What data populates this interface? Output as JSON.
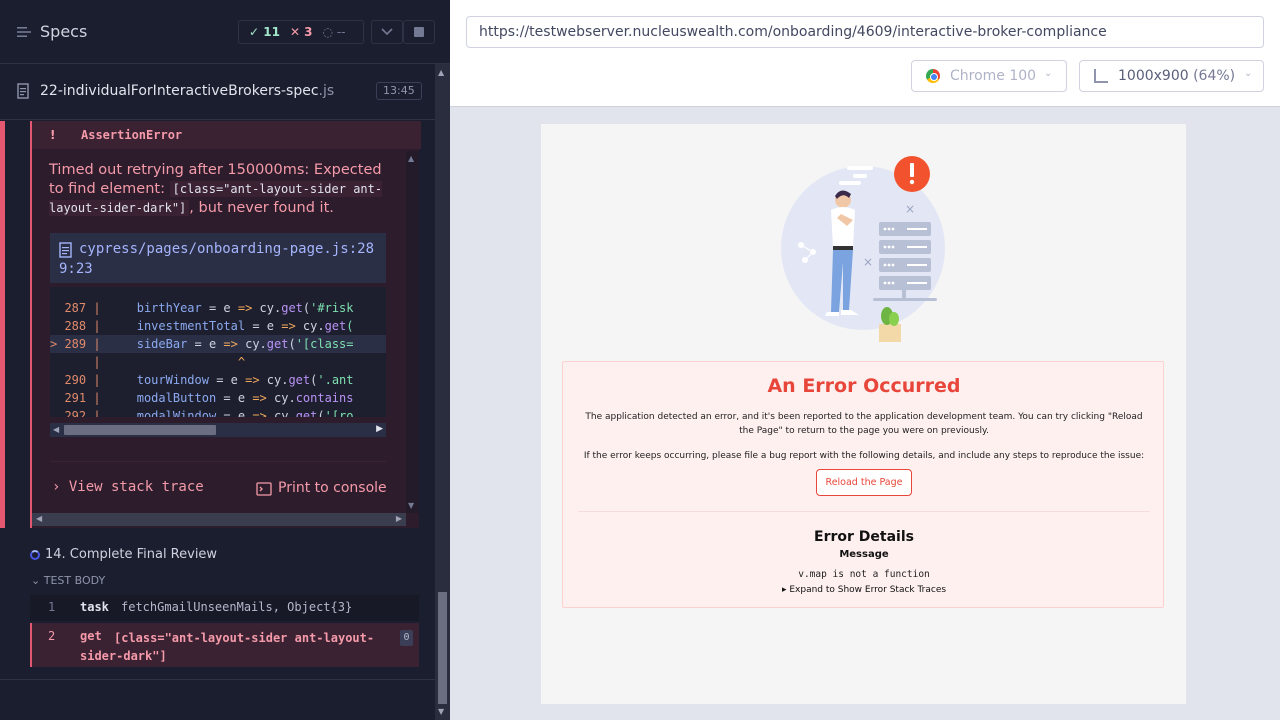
{
  "reporter": {
    "title": "Specs",
    "stats": {
      "passed": "11",
      "failed": "3",
      "pending": "--"
    },
    "file": {
      "name": "22-individualForInteractiveBrokers-spec",
      "ext": ".js",
      "duration": "13:45"
    }
  },
  "error": {
    "bang": "!",
    "name": "AssertionError",
    "message_pre": "Timed out retrying after 150000ms: Expected to find element: ",
    "selector": "[class=\"ant-layout-sider ant-layout-sider-dark\"]",
    "message_post": ", but never found it.",
    "code_frame_file": "cypress/pages/onboarding-page.js:289:23",
    "code_lines": [
      {
        "num": "287",
        "prop": "birthYear",
        "arg": "'#risk"
      },
      {
        "num": "288",
        "prop": "investmentTotal",
        "arg": "("
      },
      {
        "num": "289",
        "prop": "sideBar",
        "arg": "'[class="
      },
      {
        "num": "290",
        "prop": "tourWindow",
        "arg": "'.ant"
      },
      {
        "num": "291",
        "prop": "modalButton",
        "arg": ""
      },
      {
        "num": "292",
        "prop": "modalWindow",
        "arg": "'[ro"
      }
    ],
    "view_stack_trace": "View stack trace",
    "print_to_console": "Print to console"
  },
  "test": {
    "title": "14. Complete Final Review",
    "body_label": "TEST BODY",
    "commands": [
      {
        "num": "1",
        "name": "task",
        "message": "fetchGmailUnseenMails, Object{3}"
      },
      {
        "num": "2",
        "name": "get",
        "message": "[class=\"ant-layout-sider ant-layout-sider-dark\"]",
        "badge": "0"
      }
    ]
  },
  "aut": {
    "url": "https://testwebserver.nucleuswealth.com/onboarding/4609/interactive-broker-compliance",
    "browser": "Chrome 100",
    "viewport": "1000x900",
    "scale": "(64%)"
  },
  "app": {
    "error_title": "An Error Occurred",
    "error_desc1": "The application detected an error, and it's been reported to the application development team. You can try clicking \"Reload the Page\" to return to the page you were on previously.",
    "error_desc2": "If the error keeps occurring, please file a bug report with the following details, and include any steps to reproduce the issue:",
    "reload_label": "Reload the Page",
    "details_title": "Error Details",
    "details_sub": "Message",
    "details_message": "v.map is not a function",
    "details_expand": "Expand to Show Error Stack Traces"
  },
  "colors": {
    "fail": "#e45770",
    "pass": "#a3e7cb",
    "app_error": "#e8463a"
  }
}
